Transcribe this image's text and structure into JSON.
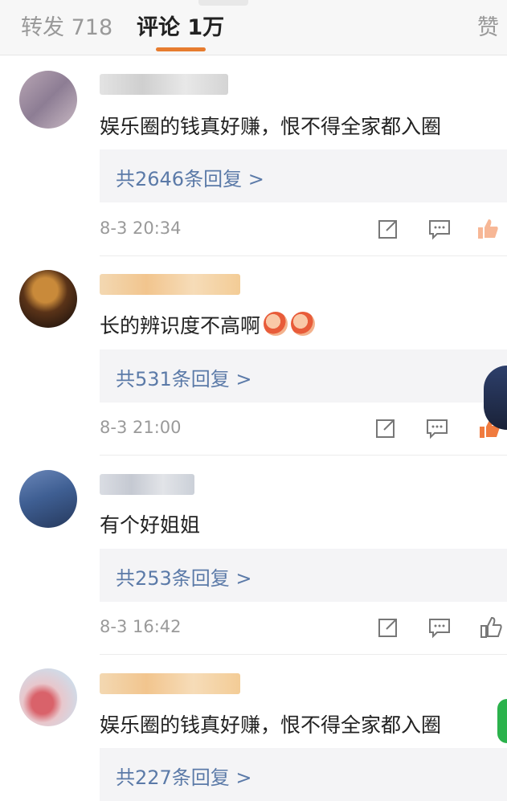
{
  "tabs": {
    "repost": "转发 718",
    "comments": "评论 1万",
    "likes": "赞"
  },
  "comments": [
    {
      "text": "娱乐圈的钱真好赚，恨不得全家都入圈",
      "replies": "共2646条回复 >",
      "time": "8-3 20:34",
      "liked": true
    },
    {
      "text": "长的辨识度不高啊",
      "replies": "共531条回复 >",
      "time": "8-3 21:00",
      "liked": true
    },
    {
      "text": "有个好姐姐",
      "replies": "共253条回复 >",
      "time": "8-3 16:42",
      "liked": false
    },
    {
      "text": "娱乐圈的钱真好赚，恨不得全家都入圈",
      "replies": "共227条回复 >",
      "time": "",
      "liked": false
    }
  ],
  "colors": {
    "accent": "#e77c2f",
    "reply_link": "#5b7aa8",
    "like_active": "#f07b3f"
  },
  "icons": [
    "share-icon",
    "comment-icon",
    "like-icon",
    "laugh-emoji-icon"
  ]
}
